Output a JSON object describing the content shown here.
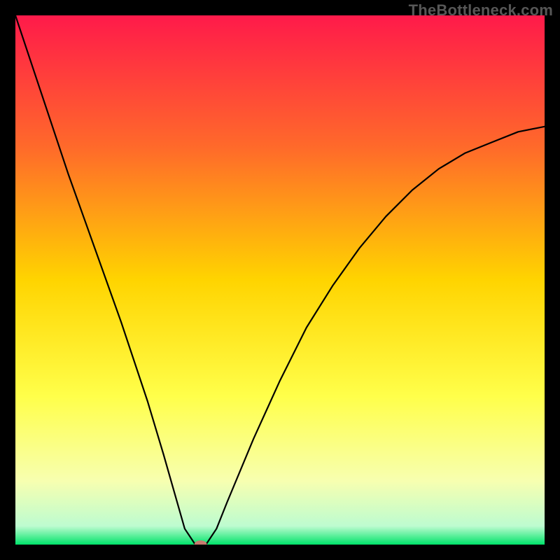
{
  "watermark": "TheBottleneck.com",
  "chart_data": {
    "type": "line",
    "title": "",
    "xlabel": "",
    "ylabel": "",
    "xlim": [
      0,
      100
    ],
    "ylim": [
      0,
      100
    ],
    "grid": false,
    "series": [
      {
        "name": "bottleneck-curve",
        "x": [
          0,
          5,
          10,
          15,
          20,
          25,
          28,
          30,
          32,
          34,
          36,
          38,
          40,
          45,
          50,
          55,
          60,
          65,
          70,
          75,
          80,
          85,
          90,
          95,
          100
        ],
        "y": [
          100,
          85,
          70,
          56,
          42,
          27,
          17,
          10,
          3,
          0,
          0,
          3,
          8,
          20,
          31,
          41,
          49,
          56,
          62,
          67,
          71,
          74,
          76,
          78,
          79
        ]
      }
    ],
    "marker": {
      "x": 35,
      "y": 0,
      "shape": "pill",
      "color": "#c77b6f"
    },
    "background_gradient": {
      "type": "vertical",
      "stops": [
        {
          "pos": 0.0,
          "color": "#ff1a4a"
        },
        {
          "pos": 0.25,
          "color": "#ff6a2a"
        },
        {
          "pos": 0.5,
          "color": "#ffd400"
        },
        {
          "pos": 0.72,
          "color": "#ffff4a"
        },
        {
          "pos": 0.88,
          "color": "#f7ffb0"
        },
        {
          "pos": 0.965,
          "color": "#bdfcd0"
        },
        {
          "pos": 1.0,
          "color": "#00e36a"
        }
      ]
    }
  }
}
